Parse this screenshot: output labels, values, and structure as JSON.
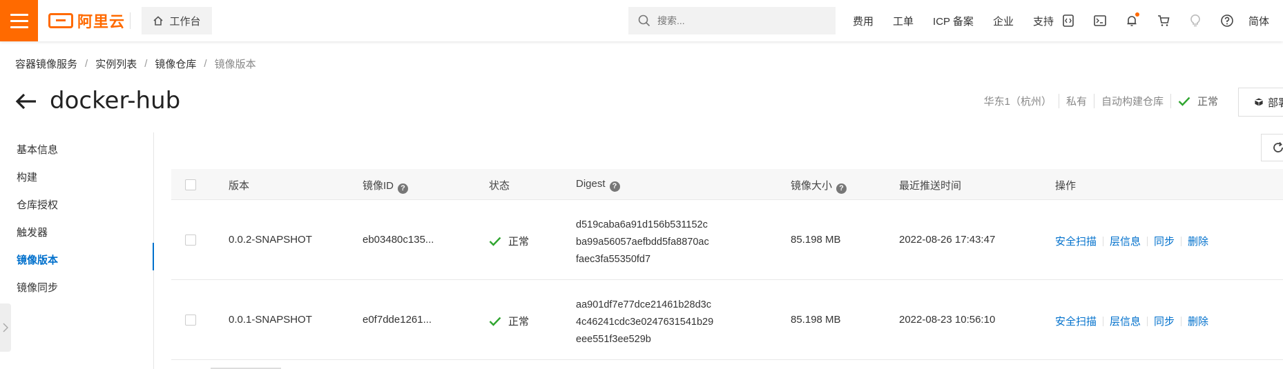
{
  "topbar": {
    "logo_text": "阿里云",
    "workbench_label": "工作台",
    "search_placeholder": "搜索...",
    "nav_links": [
      "费用",
      "工单",
      "ICP 备案",
      "企业",
      "支持"
    ],
    "icons": [
      "code-icon",
      "terminal-icon",
      "bell-icon",
      "cart-icon",
      "lightbulb-icon",
      "help-icon"
    ],
    "language": "简体"
  },
  "breadcrumb": [
    "容器镜像服务",
    "实例列表",
    "镜像仓库",
    "镜像版本"
  ],
  "header": {
    "title": "docker-hub",
    "region": "华东1（杭州）",
    "visibility": "私有",
    "build": "自动构建仓库",
    "status": "正常",
    "deploy_label": "部署"
  },
  "sidenav": {
    "items": [
      "基本信息",
      "构建",
      "仓库授权",
      "触发器",
      "镜像版本",
      "镜像同步"
    ],
    "active": "镜像版本"
  },
  "table": {
    "columns": [
      "版本",
      "镜像ID",
      "状态",
      "Digest",
      "镜像大小",
      "最近推送时间",
      "操作"
    ],
    "rows": [
      {
        "version": "0.0.2-SNAPSHOT",
        "image_id": "eb03480c135...",
        "status": "正常",
        "digest": [
          "d519caba6a91d156b531152c",
          "ba99a56057aefbdd5fa8870ac",
          "faec3fa55350fd7"
        ],
        "size": "85.198 MB",
        "pushed": "2022-08-26 17:43:47"
      },
      {
        "version": "0.0.1-SNAPSHOT",
        "image_id": "e0f7dde1261...",
        "status": "正常",
        "digest": [
          "aa901df7e77dce21461b28d3c",
          "4c46241cdc3e0247631541b29",
          "eee551f3ee529b"
        ],
        "size": "85.198 MB",
        "pushed": "2022-08-23 10:56:10"
      }
    ],
    "actions": [
      "安全扫描",
      "层信息",
      "同步",
      "删除"
    ]
  },
  "colors": {
    "brand": "#ff6a00",
    "link": "#0070cc",
    "success": "#2fa52f"
  }
}
